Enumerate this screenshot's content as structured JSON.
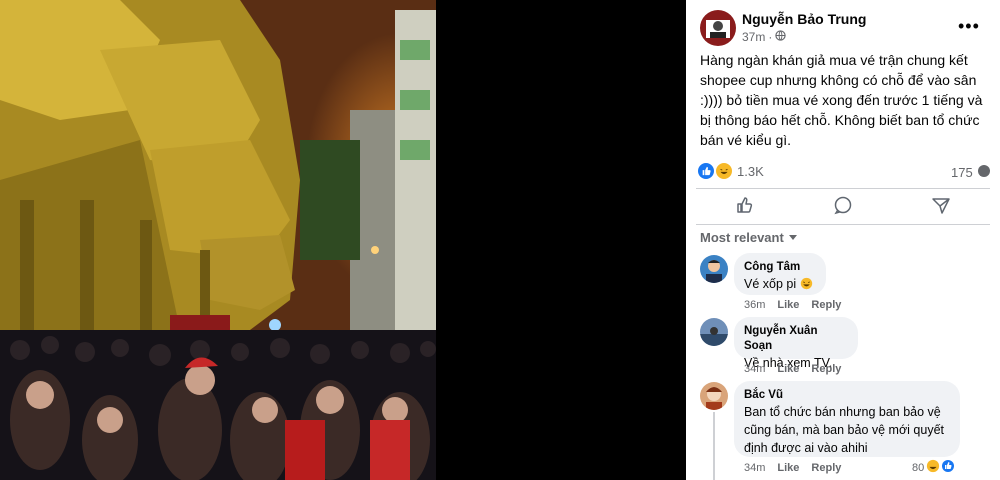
{
  "post": {
    "author": "Nguyễn Bảo Trung",
    "time": "37m",
    "privacy_sep": "·",
    "caption": "Hàng ngàn khán giả mua vé trận chung kết shopee cup nhưng không có chỗ để vào sân :)))) bỏ tiền mua vé xong đến trước 1 tiếng và bị thông báo hết chỗ. Không biết ban tổ chức bán vé kiểu gì.",
    "reaction_count": "1.3K",
    "comment_count": "175",
    "more_label": "•••"
  },
  "sort_label": "Most relevant",
  "comments": [
    {
      "name": "Công Tâm",
      "text": "Vé xốp pi",
      "time": "36m",
      "like": "Like",
      "reply": "Reply"
    },
    {
      "name": "Nguyễn Xuân Soạn",
      "text": "Về nhà xem TV.",
      "time": "34m",
      "like": "Like",
      "reply": "Reply"
    },
    {
      "name": "Bắc Vũ",
      "text": "Ban tổ chức bán nhưng ban bảo vệ cũng bán, mà ban bảo vệ mới quyết định được ai vào ahihi",
      "time": "34m",
      "like": "Like",
      "reply": "Reply",
      "reaction_count": "80"
    }
  ],
  "colors": {
    "accent": "#1877f2",
    "secondary_text": "#65676b",
    "bubble": "#f0f2f5"
  },
  "icons": [
    "globe-icon",
    "like-icon",
    "comment-icon",
    "share-icon",
    "chevron-down-icon",
    "more-icon"
  ]
}
